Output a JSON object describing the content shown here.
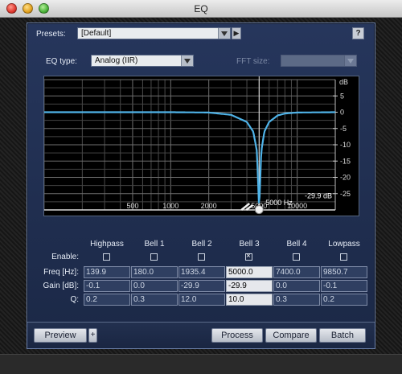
{
  "window": {
    "title": "EQ"
  },
  "presets": {
    "label": "Presets:",
    "value": "[Default]",
    "next_label": "▶",
    "help_label": "?"
  },
  "eq_type": {
    "label": "EQ type:",
    "value": "Analog (IIR)"
  },
  "fft": {
    "label": "FFT size:",
    "value": ""
  },
  "graph": {
    "db_label": "dB",
    "y_ticks": [
      "5",
      "0",
      "-5",
      "-10",
      "-15",
      "-20",
      "-25"
    ],
    "x_ticks": [
      "500",
      "1000",
      "2000",
      "5000",
      "10000"
    ],
    "readout_db": "-29.9 dB",
    "readout_hz": "5000 Hz"
  },
  "bands": {
    "enable_label": "Enable:",
    "freq_label": "Freq [Hz]:",
    "gain_label": "Gain [dB]:",
    "q_label": "Q:",
    "items": [
      {
        "name": "Highpass",
        "enabled": false,
        "freq": "139.9",
        "gain": "-0.1",
        "q": "0.2"
      },
      {
        "name": "Bell 1",
        "enabled": false,
        "freq": "180.0",
        "gain": "0.0",
        "q": "0.3"
      },
      {
        "name": "Bell 2",
        "enabled": false,
        "freq": "1935.4",
        "gain": "-29.9",
        "q": "12.0"
      },
      {
        "name": "Bell 3",
        "enabled": true,
        "freq": "5000.0",
        "gain": "-29.9",
        "q": "10.0"
      },
      {
        "name": "Bell 4",
        "enabled": false,
        "freq": "7400.0",
        "gain": "0.0",
        "q": "0.3"
      },
      {
        "name": "Lowpass",
        "enabled": false,
        "freq": "9850.7",
        "gain": "-0.1",
        "q": "0.2"
      }
    ]
  },
  "footer": {
    "preview_label": "Preview",
    "plus_label": "+",
    "process_label": "Process",
    "compare_label": "Compare",
    "batch_label": "Batch"
  },
  "colors": {
    "curve": "#4fb3e8",
    "panel": "#1f2d4d",
    "grid": "#5a5a5a",
    "active_cell": "#e6e8ec"
  },
  "chart_data": {
    "type": "line",
    "x_scale": "log",
    "x_ticks": [
      500,
      1000,
      2000,
      5000,
      10000
    ],
    "ylim": [
      -30,
      10
    ],
    "y_ticks": [
      5,
      0,
      -5,
      -10,
      -15,
      -20,
      -25
    ],
    "ylabel": "dB",
    "series": [
      {
        "x": [
          100,
          1000,
          2000,
          3000,
          4000,
          4500,
          4800,
          5000,
          5200,
          5500,
          6000,
          7000,
          8000,
          10000,
          20000
        ],
        "y": [
          0,
          0,
          -0.1,
          -0.8,
          -3,
          -6,
          -12,
          -29.9,
          -12,
          -6,
          -3,
          -1,
          -0.4,
          -0.1,
          0
        ]
      }
    ],
    "grid": true
  }
}
